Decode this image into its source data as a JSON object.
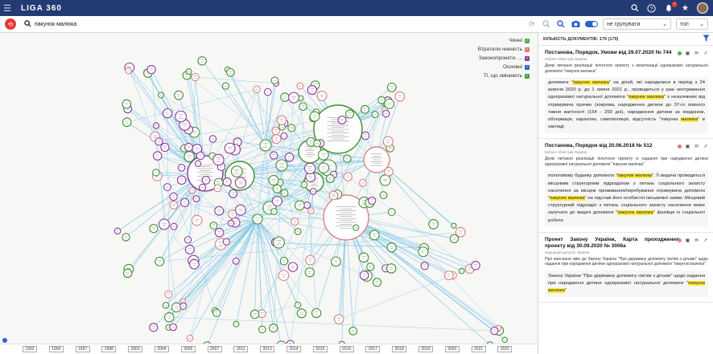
{
  "app": {
    "title": "LIGA 360"
  },
  "search": {
    "query": "пакунок малюка"
  },
  "toolbar": {
    "group_select": "не групувати",
    "sort_select": "топ"
  },
  "legend": [
    {
      "label": "Чинні",
      "color": "#4caf50"
    },
    {
      "label": "Втратили чинність",
      "color": "#e57373"
    },
    {
      "label": "Законопроекти, ...",
      "color": "#8e3a9e"
    },
    {
      "label": "Основні",
      "color": "#2a63c9"
    },
    {
      "label": "Ті, що змінюють",
      "color": "#43a047"
    }
  ],
  "timeline": {
    "years": [
      "1992",
      "1996",
      "1997",
      "1998",
      "2002",
      "2004",
      "2005",
      "2007",
      "2011",
      "2013",
      "2014",
      "2015",
      "2016",
      "2017",
      "2018",
      "2019",
      "2020",
      "2021",
      "2022"
    ]
  },
  "panel": {
    "count_label": "КІЛЬКІСТЬ ДОКУМЕНТІВ: 179 (179)",
    "docs": [
      {
        "title": "Постанова, Порядок, Умови від 29.07.2020 № 744",
        "issuer": "Кабінет Міністрів України",
        "status_color": "#4caf50",
        "desc": "Деякі питання реалізації пілотного проекту з монетизації одноразової натуральної допомоги \"пакунок малюка\"",
        "snip": [
          {
            "t": "допомоги \""
          },
          {
            "t": "пакунок малюка",
            "hl": true
          },
          {
            "t": "\" на дітей, які народилися в період з 24 жовтня 2020 р. до 1 липня 2021 р., проводиться у разі неотримання одноразової натуральної допомоги \""
          },
          {
            "t": "пакунок малюка",
            "hl": true
          },
          {
            "t": "\" з незалежних від отримувача причин (зокрема, народження дитини до 37-го повного тижня вагітності (154 - 259 дні), народження дитини за кордоном, обсервація, карантин, самоізоляція, відсутність \"пакунка "
          },
          {
            "t": "малюка",
            "hl": true
          },
          {
            "t": "\" в закладі"
          }
        ]
      },
      {
        "title": "Постанова, Порядок від 20.06.2018 № 512",
        "issuer": "Кабінет Міністрів України",
        "status_color": "#e57373",
        "desc": "Деякі питання реалізації пілотного проекту із надання при народженні дитини одноразової натуральної допомоги \"пакунок малюка\"",
        "snip": [
          {
            "t": "пологовому будинку допомоги \""
          },
          {
            "t": "пакунок малюка",
            "hl": true
          },
          {
            "t": "\". Її видача проводиться місцевим структурним підрозділом з питань соціального захисту населення за місцем проживання/перебування отримувача допомоги \""
          },
          {
            "t": "пакунок малюка",
            "hl": true
          },
          {
            "t": "\" на підставі його особистої письмової заяви. Місцевий структурний підрозділ з питань соціального захисту населення може залучати до видачі допомоги \""
          },
          {
            "t": "пакунок малюка",
            "hl": true
          },
          {
            "t": "\" фахівця із соціальної роботи"
          }
        ]
      },
      {
        "title": "Проект Закону України, Карта проходження проекту від 30.09.2020 № 3006а",
        "issuer": "Народний депутат України",
        "status_color": "#e07bd0",
        "desc": "Про внесення змін до Закону України \"Про державну допомогу сім'ям з дітьми\" щодо надання при народженні дитини одноразової натуральної допомоги \"пакунок малюка\"",
        "snip": [
          {
            "t": "Закону України \"Про державну допомогу сім'ям з дітьми\" щодо надання при народженні дитини одноразової натуральної допомоги \""
          },
          {
            "t": "пакунок малюка",
            "hl": true
          },
          {
            "t": "\""
          }
        ]
      }
    ]
  }
}
